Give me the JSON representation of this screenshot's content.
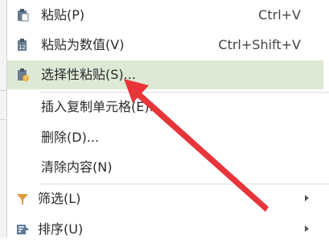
{
  "menu": {
    "paste": {
      "label": "粘贴(P)",
      "shortcut": "Ctrl+V",
      "icon": "paste-icon"
    },
    "paste_values": {
      "label": "粘贴为数值(V)",
      "shortcut": "Ctrl+Shift+V",
      "icon": "paste-values-icon"
    },
    "paste_special": {
      "label": "选择性粘贴(S)...",
      "icon": "paste-special-icon"
    },
    "insert_copied": {
      "label": "插入复制单元格(E)..."
    },
    "delete": {
      "label": "删除(D)..."
    },
    "clear": {
      "label": "清除内容(N)"
    },
    "filter": {
      "label": "筛选(L)",
      "icon": "filter-icon"
    },
    "sort": {
      "label": "排序(U)",
      "icon": "sort-icon"
    }
  },
  "colors": {
    "highlight": "#dde9d5",
    "annotation_arrow": "#e8353a"
  }
}
